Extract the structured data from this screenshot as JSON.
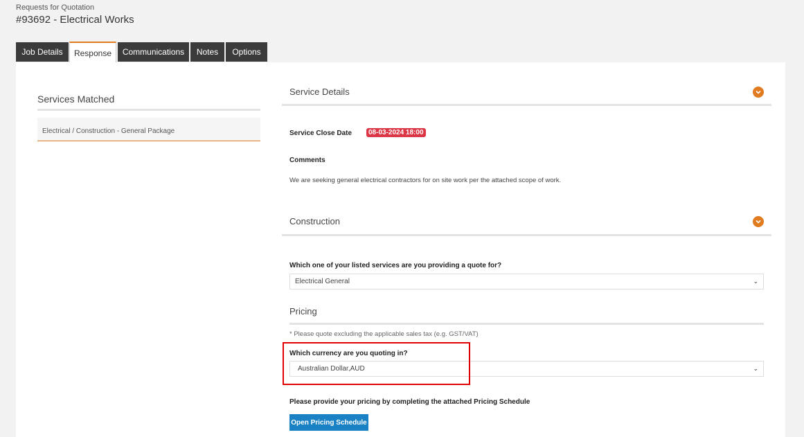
{
  "header": {
    "breadcrumb": "Requests for Quotation",
    "title": "#93692 - Electrical Works"
  },
  "tabs": [
    {
      "label": "Job Details"
    },
    {
      "label": "Response"
    },
    {
      "label": "Communications"
    },
    {
      "label": "Notes"
    },
    {
      "label": "Options"
    }
  ],
  "services_matched": {
    "title": "Services Matched",
    "item": "Electrical / Construction - General Package"
  },
  "service_details": {
    "title": "Service Details",
    "close_date_label": "Service Close Date",
    "close_date_value": "08-03-2024 18:00",
    "comments_label": "Comments",
    "comments_text": "We are seeking general electrical contractors for on site work per the attached scope of work."
  },
  "construction": {
    "title": "Construction",
    "question": "Which one of your listed services are you providing a quote for?",
    "selected": "Electrical General"
  },
  "pricing": {
    "title": "Pricing",
    "note": "* Please quote excluding the applicable sales tax (e.g. GST/VAT)",
    "currency_question": "Which currency are you quoting in?",
    "currency_selected": "Australian Dollar,AUD",
    "schedule_prompt": "Please provide your pricing by completing the attached Pricing Schedule",
    "schedule_button": "Open Pricing Schedule"
  },
  "colors": {
    "accent": "#e07b1f",
    "tab_dark": "#3b3b3b",
    "badge": "#dc3545",
    "button": "#1a82c4",
    "highlight": "#e00000"
  }
}
